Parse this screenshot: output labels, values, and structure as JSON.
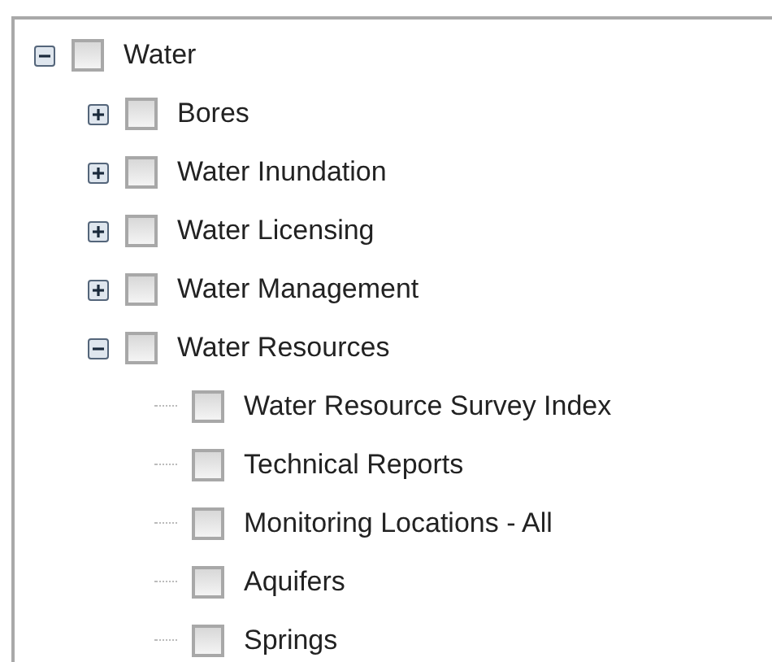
{
  "tree": [
    {
      "label": "Water",
      "checked": false,
      "expanded": true,
      "children": [
        {
          "label": "Bores",
          "checked": false,
          "expanded": false
        },
        {
          "label": "Water Inundation",
          "checked": false,
          "expanded": false
        },
        {
          "label": "Water Licensing",
          "checked": false,
          "expanded": false
        },
        {
          "label": "Water Management",
          "checked": false,
          "expanded": false
        },
        {
          "label": "Water Resources",
          "checked": false,
          "expanded": true,
          "children": [
            {
              "label": "Water Resource Survey Index",
              "checked": false
            },
            {
              "label": "Technical Reports",
              "checked": false
            },
            {
              "label": "Monitoring Locations - All",
              "checked": false
            },
            {
              "label": "Aquifers",
              "checked": false
            },
            {
              "label": "Springs",
              "checked": false
            }
          ]
        }
      ]
    }
  ]
}
